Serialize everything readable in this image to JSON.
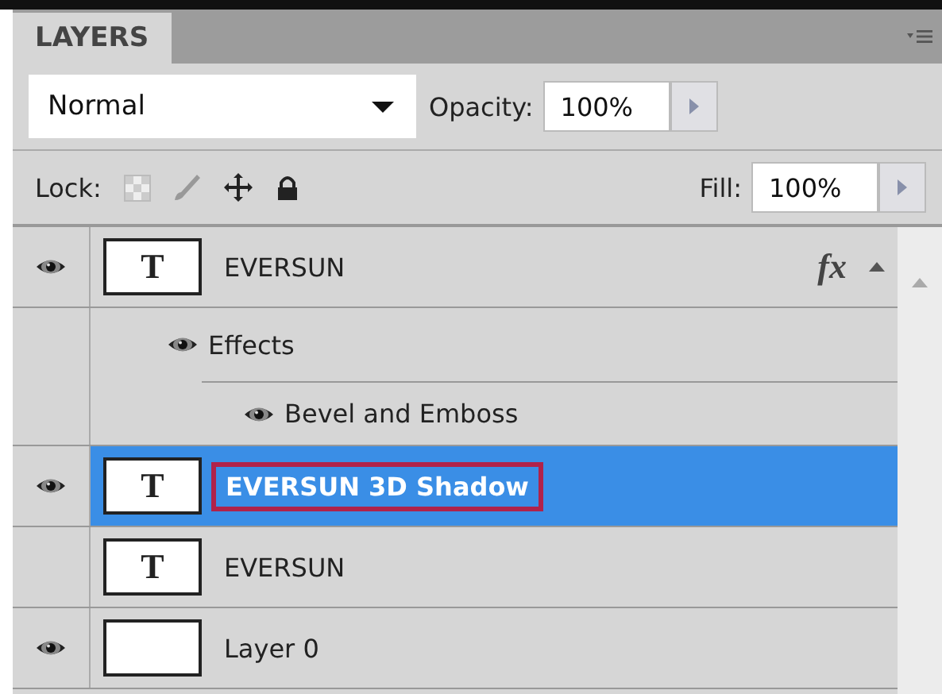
{
  "panel": {
    "tab": {
      "label": "LAYERS",
      "selected": true
    }
  },
  "blend_mode": {
    "value": "Normal"
  },
  "opacity": {
    "label": "Opacity:",
    "value": "100%"
  },
  "lock": {
    "label": "Lock:"
  },
  "fill": {
    "label": "Fill:",
    "value": "100%"
  },
  "layers": [
    {
      "name": "EVERSUN",
      "thumb": "T",
      "visible": true,
      "selected": false,
      "editing": false,
      "fx": "fx",
      "expanded": true,
      "effects": {
        "name": "Effects",
        "visible": true,
        "children": [
          {
            "name": "Bevel and Emboss",
            "visible": true
          }
        ]
      }
    },
    {
      "name": "EVERSUN 3D Shadow",
      "thumb": "T",
      "visible": true,
      "selected": true,
      "editing": true
    },
    {
      "name": "EVERSUN",
      "thumb": "T",
      "visible": false,
      "selected": false,
      "editing": false
    },
    {
      "name": "Layer 0",
      "visible": true,
      "selected": false,
      "editing": false
    }
  ]
}
